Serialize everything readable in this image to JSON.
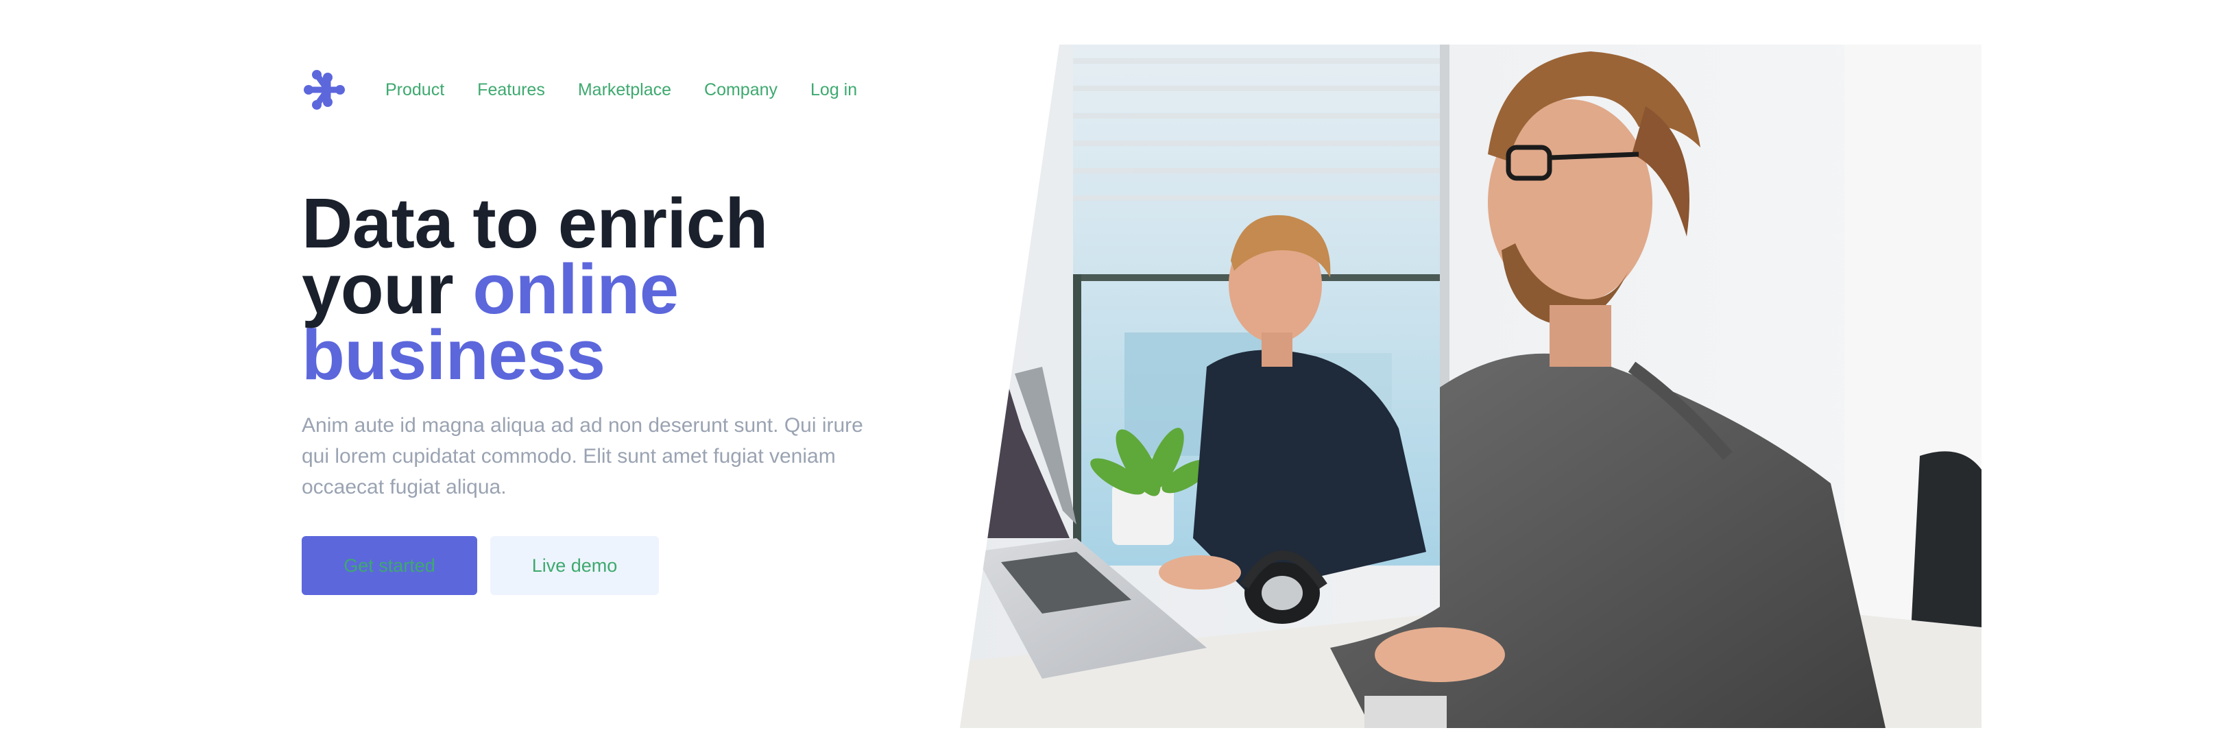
{
  "nav": {
    "logo_icon": "asterisk-dots-logo-icon",
    "links": [
      "Product",
      "Features",
      "Marketplace",
      "Company",
      "Log in"
    ]
  },
  "hero": {
    "headline_line1": "Data to enrich",
    "headline_line2": "your ",
    "headline_accent": "online business",
    "description": "Anim aute id magna aliqua ad ad non deserunt sunt. Qui irure qui lorem cupidatat commodo. Elit sunt amet fugiat veniam occaecat fugiat aliqua.",
    "primary_cta": "Get started",
    "secondary_cta": "Live demo"
  },
  "image": {
    "subject": "two-men-working-at-laptops-photo"
  },
  "colors": {
    "accent": "#5c67dc",
    "link": "#3ea96f",
    "heading": "#1a202c",
    "muted": "#9aa3b2",
    "secondary_button_bg": "#eef4fd"
  }
}
